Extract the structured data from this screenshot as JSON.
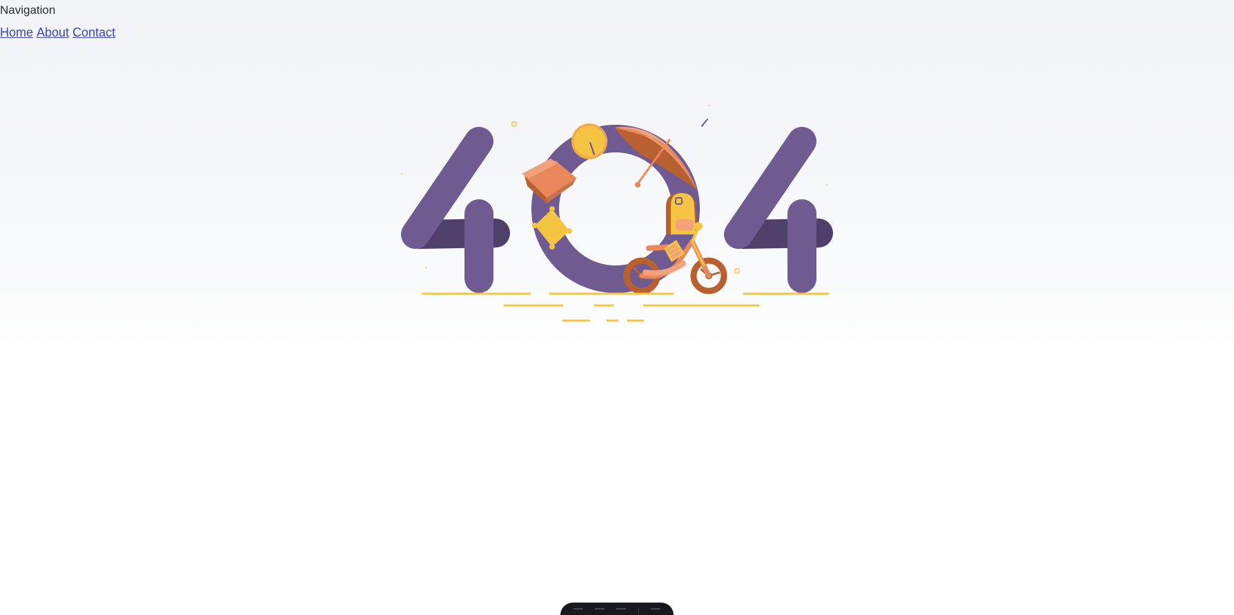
{
  "nav": {
    "heading": "Navigation",
    "links": [
      {
        "label": "Home"
      },
      {
        "label": "About"
      },
      {
        "label": "Contact"
      }
    ]
  },
  "illustration": {
    "text": "404",
    "colors": {
      "purple": "#6f5a92",
      "purple_dark": "#4f3f6b",
      "yellow": "#f6c443",
      "orange": "#e9885b",
      "rust": "#b8602f",
      "peach": "#f2a17a"
    },
    "icons": [
      "clock-icon",
      "umbrella-icon",
      "box-icon",
      "pillow-icon",
      "backpack-icon",
      "bicycle-icon",
      "book-icon"
    ]
  },
  "toolbar": {
    "icons": [
      "microphone-icon",
      "camera-icon",
      "menu-icon",
      "settings-icon"
    ]
  }
}
